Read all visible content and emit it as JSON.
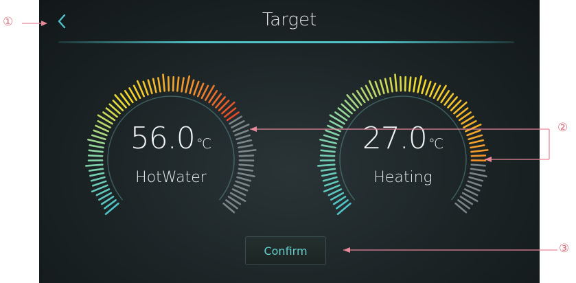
{
  "header": {
    "title": "Target",
    "back_icon": "chevron-left-icon"
  },
  "gauges": [
    {
      "id": "hot-water",
      "value": "56.0",
      "unit": "℃",
      "label": "HotWater",
      "level_fraction": 0.72
    },
    {
      "id": "heating",
      "value": "27.0",
      "unit": "℃",
      "label": "Heating",
      "level_fraction": 0.86
    }
  ],
  "actions": {
    "confirm_label": "Confirm"
  },
  "callouts": {
    "back": "①",
    "gauges": "②",
    "confirm": "③"
  },
  "colors": {
    "accent": "#4fc3c8",
    "callout": "#e8899a",
    "screen_bg": "#1b2325",
    "tick_gradient": [
      "#4fc3c8",
      "#8ed6a3",
      "#f5dc2a",
      "#f39a2c",
      "#e3462a"
    ],
    "tick_inactive": "#9aa3a5"
  }
}
